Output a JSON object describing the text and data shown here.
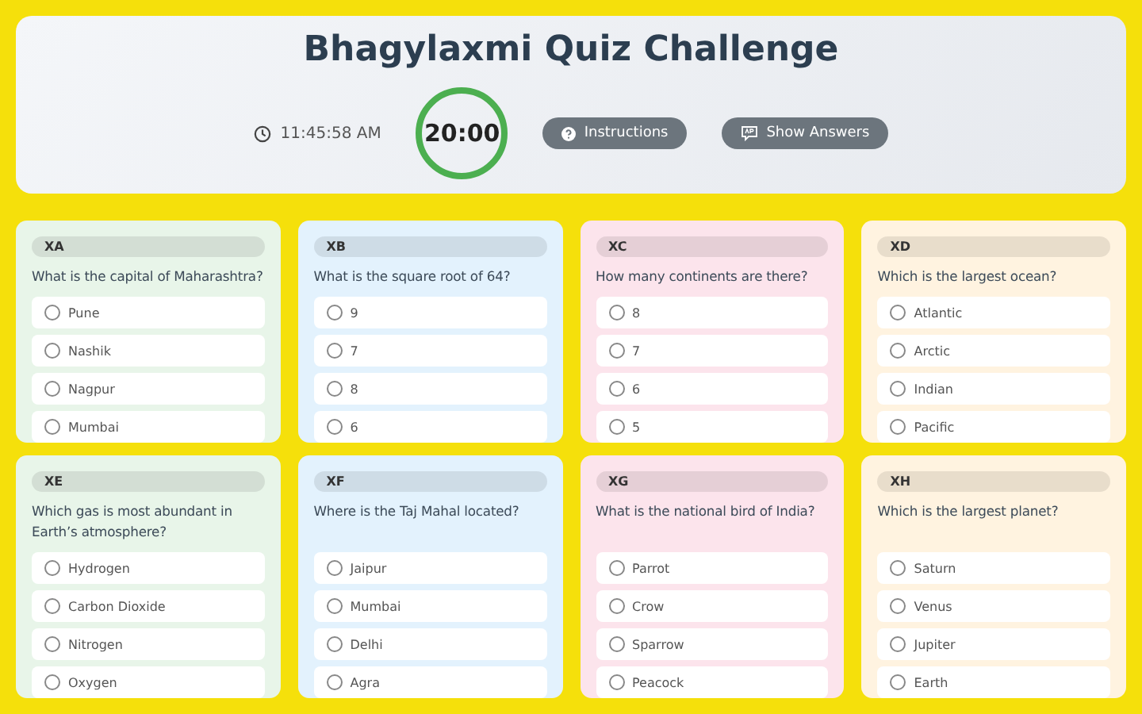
{
  "header": {
    "title": "Bhagylaxmi Quiz Challenge",
    "clock": "11:45:58 AM",
    "timer": "20:00",
    "buttons": [
      {
        "label": "Instructions",
        "kind": "help"
      },
      {
        "label": "Show Answers",
        "kind": "answers"
      }
    ]
  },
  "questions": [
    {
      "tag": "XA",
      "color": "#e8f5e9",
      "text": "What is the capital of Maharashtra?",
      "options": [
        {
          "label": "Pune",
          "selected": false
        },
        {
          "label": "Nashik",
          "selected": false
        },
        {
          "label": "Nagpur",
          "selected": false
        },
        {
          "label": "Mumbai",
          "selected": false
        }
      ]
    },
    {
      "tag": "XB",
      "color": "#e3f2fd",
      "text": "What is the square root of 64?",
      "options": [
        {
          "label": "9",
          "selected": false
        },
        {
          "label": "7",
          "selected": false
        },
        {
          "label": "8",
          "selected": false
        },
        {
          "label": "6",
          "selected": false
        }
      ]
    },
    {
      "tag": "XC",
      "color": "#fce4ec",
      "text": "How many continents are there?",
      "options": [
        {
          "label": "8",
          "selected": false
        },
        {
          "label": "7",
          "selected": false
        },
        {
          "label": "6",
          "selected": false
        },
        {
          "label": "5",
          "selected": false
        }
      ]
    },
    {
      "tag": "XD",
      "color": "#fff3e0",
      "text": "Which is the largest ocean?",
      "options": [
        {
          "label": "Atlantic",
          "selected": false
        },
        {
          "label": "Arctic",
          "selected": false
        },
        {
          "label": "Indian",
          "selected": false
        },
        {
          "label": "Pacific",
          "selected": false
        }
      ]
    },
    {
      "tag": "XE",
      "color": "#e8f5e9",
      "text": "Which gas is most abundant in Earth’s atmosphere?",
      "options": [
        {
          "label": "Hydrogen",
          "selected": false
        },
        {
          "label": "Carbon Dioxide",
          "selected": false
        },
        {
          "label": "Nitrogen",
          "selected": false
        },
        {
          "label": "Oxygen",
          "selected": false
        }
      ]
    },
    {
      "tag": "XF",
      "color": "#e3f2fd",
      "text": "Where is the Taj Mahal located?",
      "options": [
        {
          "label": "Jaipur",
          "selected": false
        },
        {
          "label": "Mumbai",
          "selected": false
        },
        {
          "label": "Delhi",
          "selected": false
        },
        {
          "label": "Agra",
          "selected": false
        }
      ]
    },
    {
      "tag": "XG",
      "color": "#fce4ec",
      "text": "What is the national bird of India?",
      "options": [
        {
          "label": "Parrot",
          "selected": false
        },
        {
          "label": "Crow",
          "selected": false
        },
        {
          "label": "Sparrow",
          "selected": false
        },
        {
          "label": "Peacock",
          "selected": false
        }
      ]
    },
    {
      "tag": "XH",
      "color": "#fff3e0",
      "text": "Which is the largest planet?",
      "options": [
        {
          "label": "Saturn",
          "selected": false
        },
        {
          "label": "Venus",
          "selected": false
        },
        {
          "label": "Jupiter",
          "selected": false
        },
        {
          "label": "Earth",
          "selected": false
        }
      ]
    }
  ]
}
